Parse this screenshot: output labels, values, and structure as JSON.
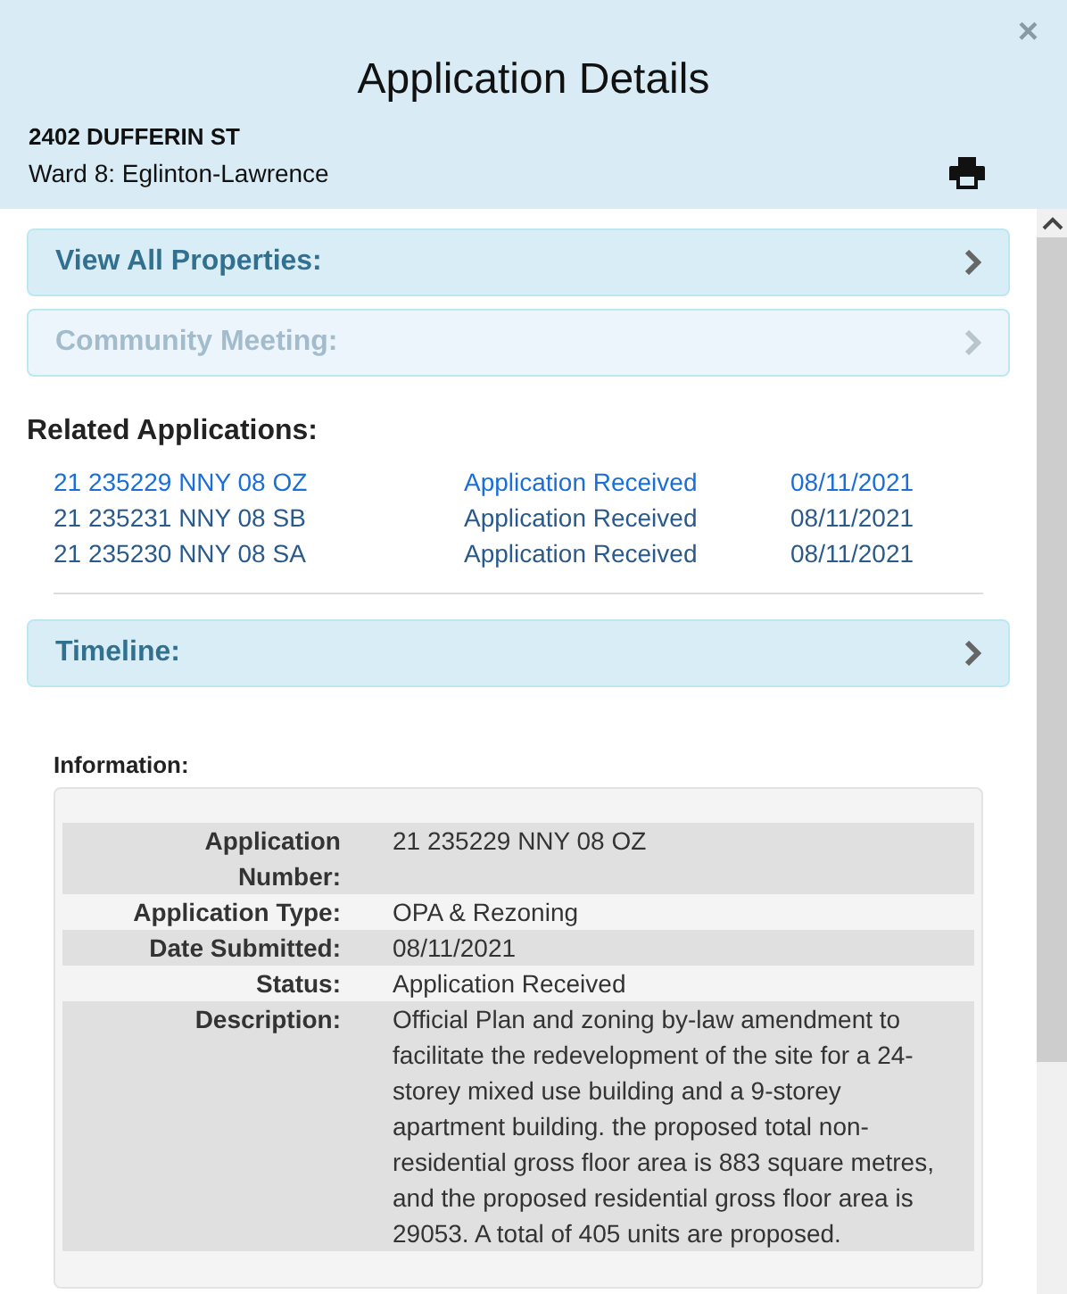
{
  "window": {
    "title": "Application Details",
    "close": "×"
  },
  "address": "2402 DUFFERIN ST",
  "ward": "Ward 8: Eglinton-Lawrence",
  "panels": [
    {
      "label": "View All Properties:",
      "disabled": false
    },
    {
      "label": "Community Meeting:",
      "disabled": true
    }
  ],
  "related": {
    "title": "Related Applications:",
    "rows": [
      {
        "number": "21 235229 NNY 08 OZ",
        "status": "Application Received",
        "date": "08/11/2021",
        "selected": true
      },
      {
        "number": "21 235231 NNY 08 SB",
        "status": "Application Received",
        "date": "08/11/2021",
        "selected": false
      },
      {
        "number": "21 235230 NNY 08 SA",
        "status": "Application Received",
        "date": "08/11/2021",
        "selected": false
      }
    ]
  },
  "timeline": {
    "label": "Timeline:",
    "disabled": false
  },
  "information": {
    "title": "Information:",
    "rows": [
      {
        "label": "Application Number:",
        "value": "21 235229 NNY 08 OZ"
      },
      {
        "label": "Application Type:",
        "value": "OPA & Rezoning"
      },
      {
        "label": "Date Submitted:",
        "value": "08/11/2021"
      },
      {
        "label": "Status:",
        "value": "Application Received"
      },
      {
        "label": "Description:",
        "value": "Official Plan and zoning by-law amendment to facilitate the redevelopment of the site for a 24-storey mixed use building and a 9-storey apartment building. the proposed total non-residential gross floor area is 883 square metres, and the proposed residential gross floor area is 29053. A total of 405 units are proposed."
      }
    ]
  }
}
